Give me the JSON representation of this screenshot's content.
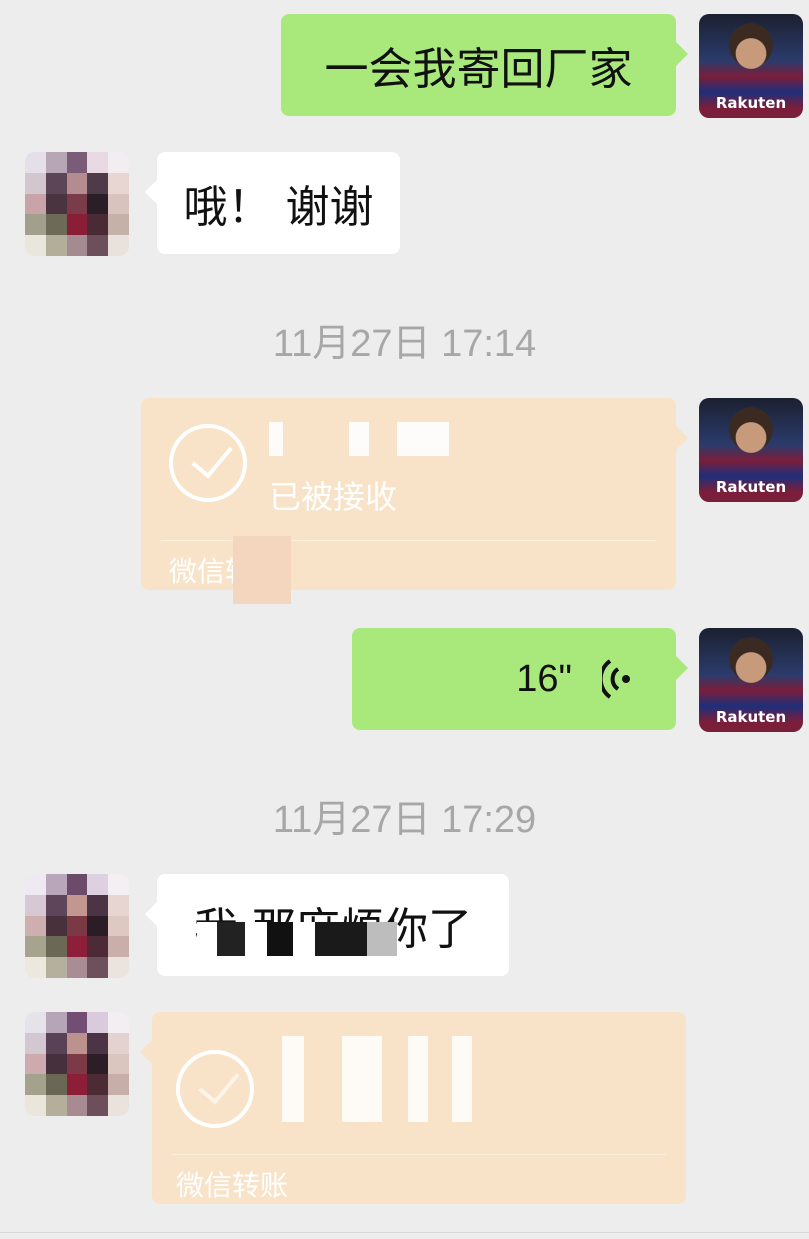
{
  "messages": [
    {
      "side": "right",
      "type": "text",
      "text": "一会我寄回厂家"
    },
    {
      "side": "left",
      "type": "text",
      "text": "哦！ 谢谢"
    },
    {
      "side": "center",
      "type": "timestamp",
      "text": "11月27日 17:14"
    },
    {
      "side": "right",
      "type": "transfer",
      "status": "已被接收",
      "footer": "微信转账"
    },
    {
      "side": "right",
      "type": "voice",
      "duration": "16\""
    },
    {
      "side": "center",
      "type": "timestamp",
      "text": "11月27日 17:29"
    },
    {
      "side": "left",
      "type": "text",
      "text": "我 那麻烦你了"
    },
    {
      "side": "left",
      "type": "transfer",
      "status": "",
      "footer": "微信转账"
    }
  ],
  "avatars": {
    "me_brand_text": "Rakuten"
  },
  "colors": {
    "background": "#ededed",
    "bubble_green": "#a9e97c",
    "bubble_white": "#ffffff",
    "transfer_bubble": "#f8e3c8",
    "timestamp": "#a7a7a7"
  },
  "icons": {
    "transfer_received": "check-circle-icon",
    "voice": "voice-wave-icon"
  }
}
